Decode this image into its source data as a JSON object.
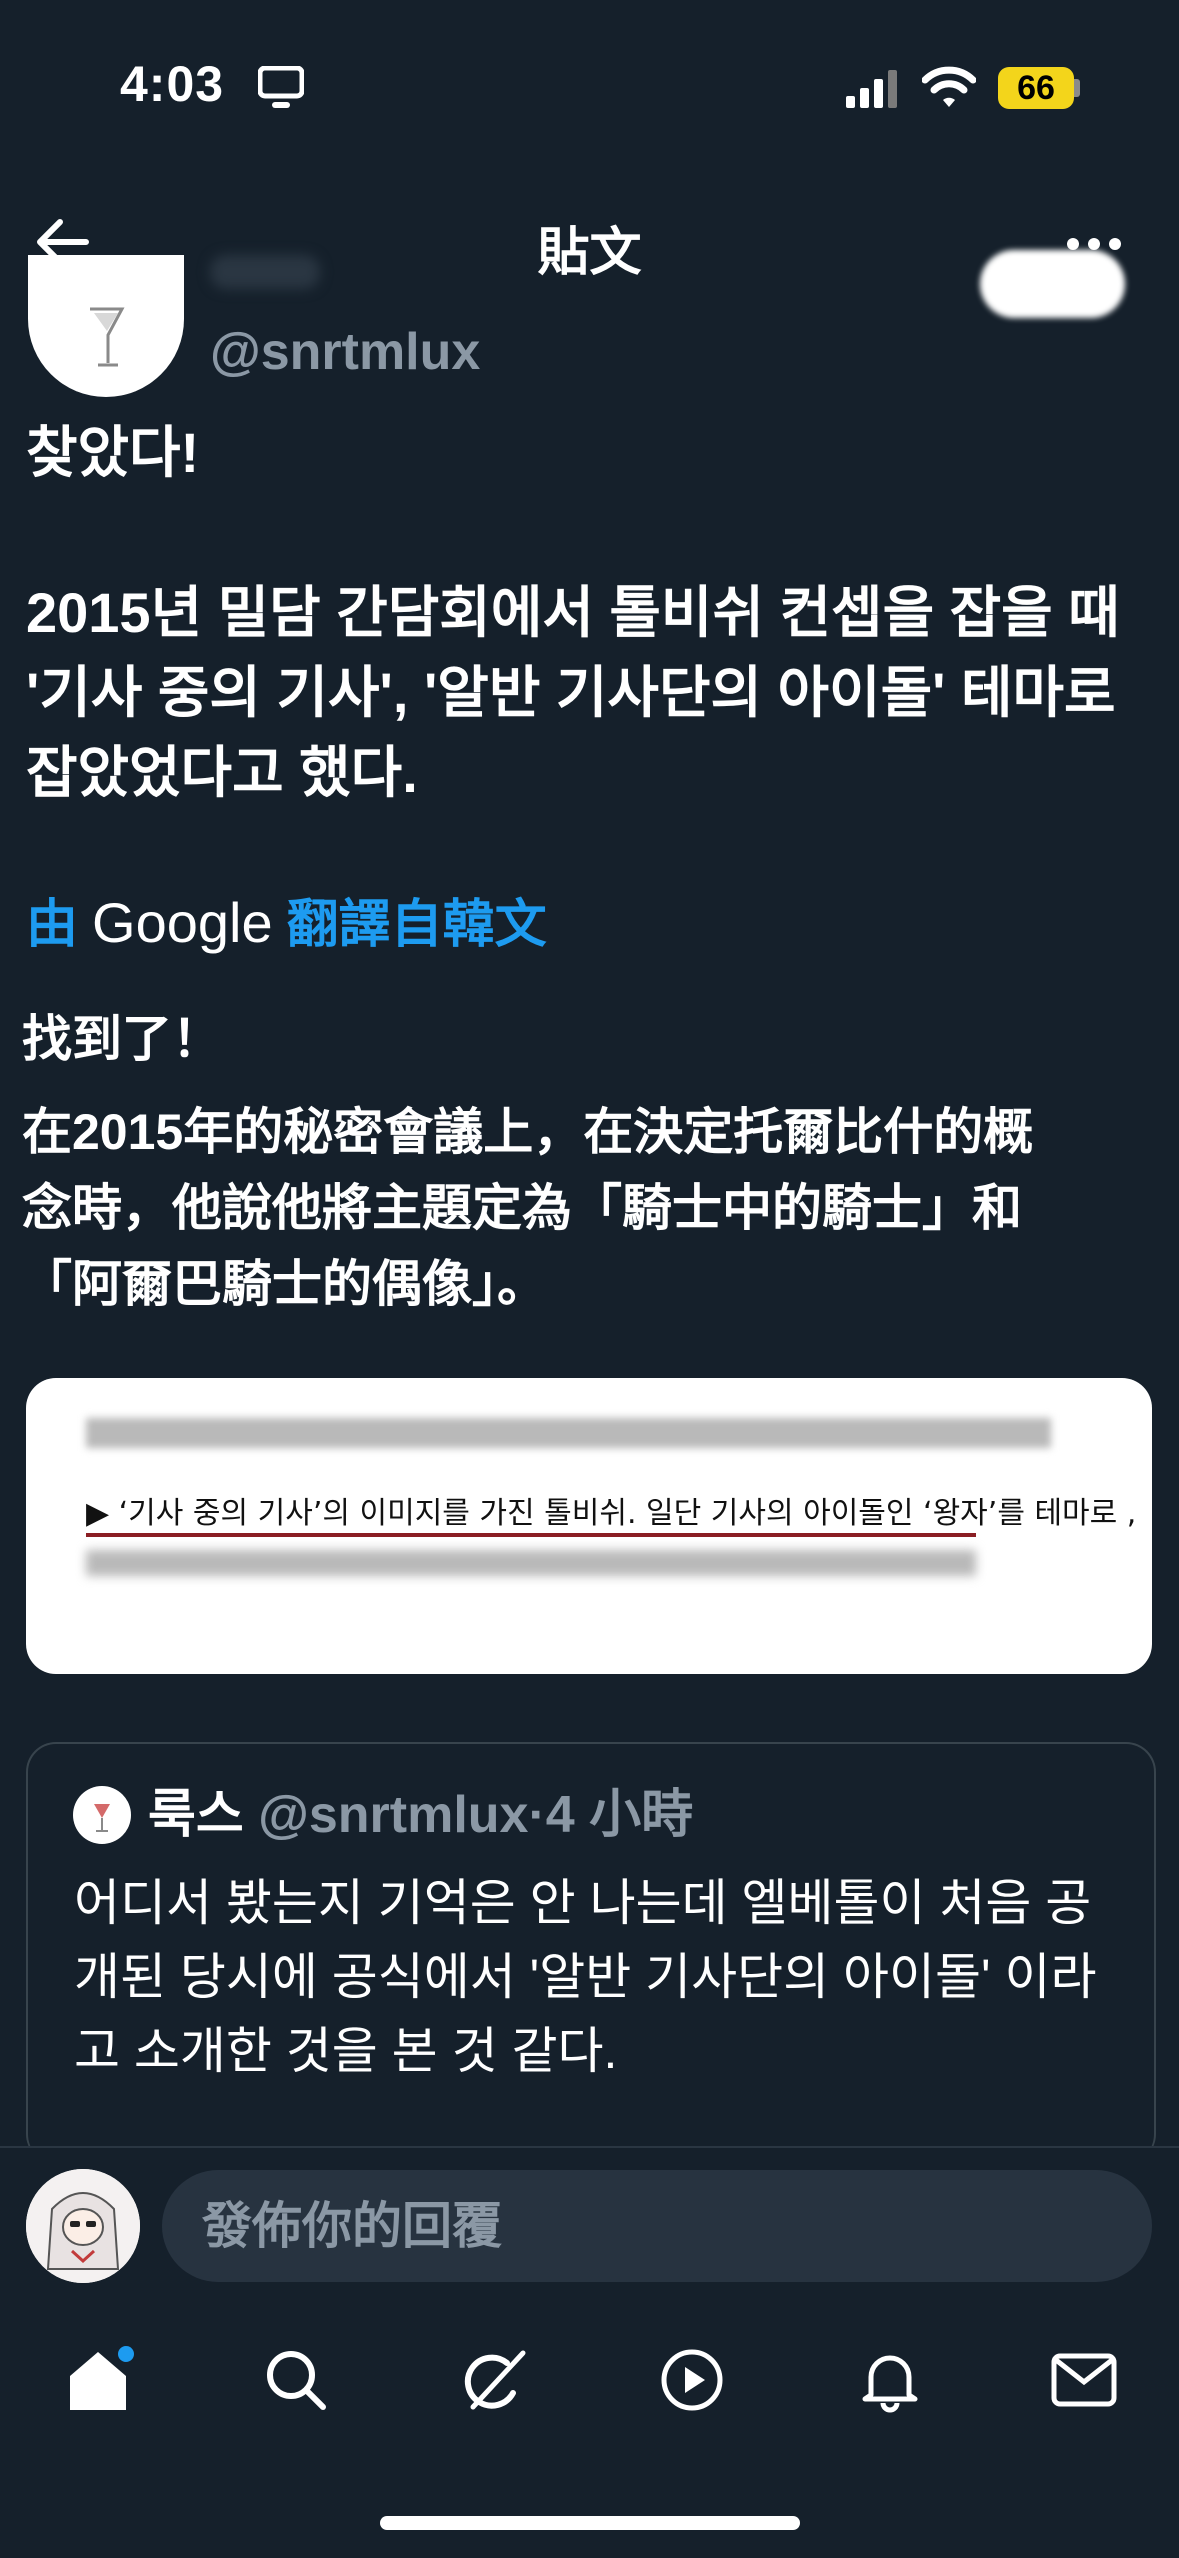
{
  "status_bar": {
    "time": "4:03",
    "battery": "66"
  },
  "header": {
    "title": "貼文"
  },
  "post": {
    "handle": "@snrtmlux",
    "text_lines": [
      "찾았다!",
      "2015년 밀담 간담회에서 톨비쉬 컨셉을 잡을 때",
      "'기사 중의 기사', '알반 기사단의 아이돌' 테마로",
      "잡았었다고 했다."
    ],
    "translation": {
      "by": "由",
      "service": "Google",
      "from": "翻譯自韓文",
      "lines": [
        "找到了！",
        "在2015年的秘密會議上，在決定托爾比什的概",
        "念時，他說他將主題定為「騎士中的騎士」和",
        "「阿爾巴騎士的偶像」。"
      ]
    },
    "media": {
      "caption": "▶ ‘기사 중의 기사’의 이미지를 가진 톨비쉬. 일단 기사의 아이돌인 ‘왕자’를 테마로 ,"
    }
  },
  "quote": {
    "name": "룩스",
    "handle": "@snrtmlux",
    "separator": "·",
    "time": "4 小時",
    "text": "어디서 봤는지 기억은 안 나는데 엘베톨이 처음 공개된 당시에 공식에서  '알반 기사단의 아이돌' 이라고 소개한 것을 본 것 같다."
  },
  "reply": {
    "placeholder": "發佈你的回覆"
  },
  "tabs": [
    "home-icon",
    "search-icon",
    "grok-icon",
    "video-icon",
    "notifications-icon",
    "messages-icon"
  ],
  "colors": {
    "background": "#15202b",
    "accent": "#1d9bf0",
    "muted": "#8b98a5",
    "battery": "#f3d51b"
  }
}
